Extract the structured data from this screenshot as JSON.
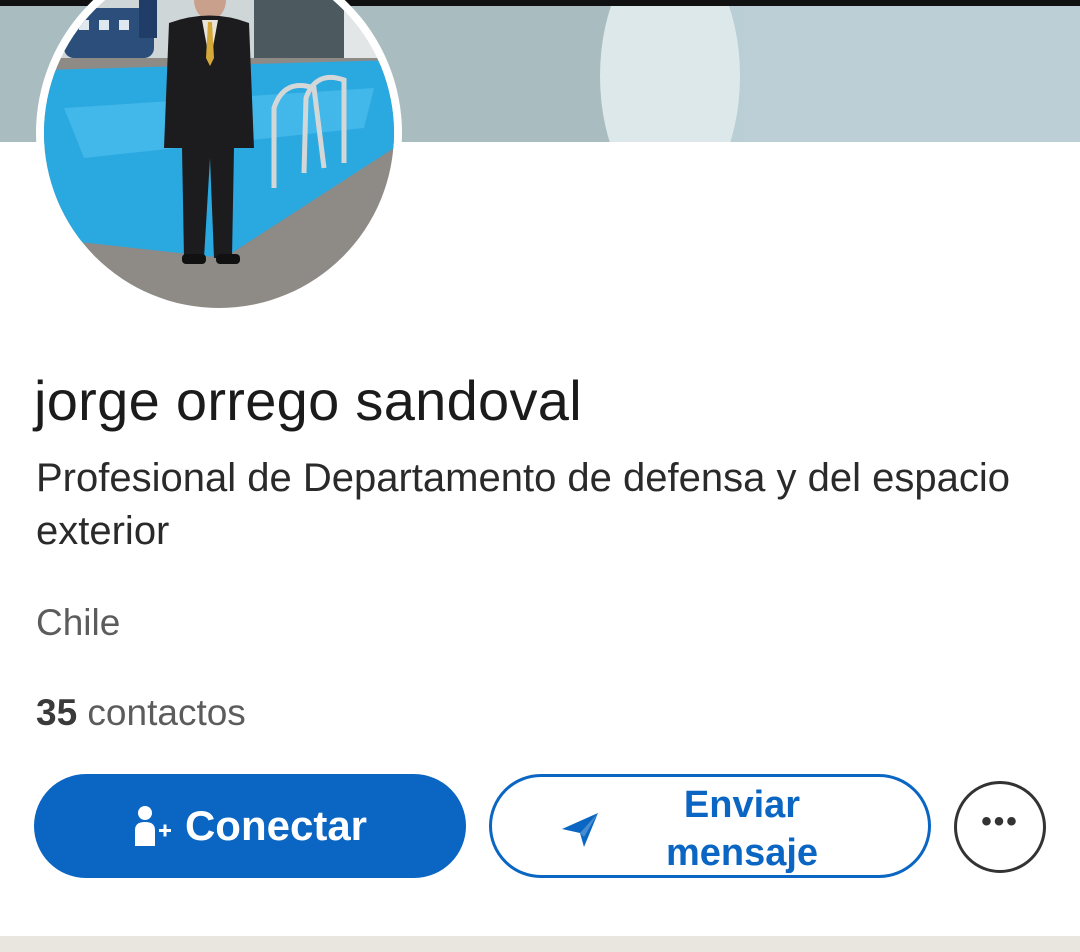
{
  "profile": {
    "name": "jorge orrego sandoval",
    "headline": "Profesional de Departamento de defensa y del espacio exterior",
    "location": "Chile",
    "connections_count": "35",
    "connections_label": " contactos"
  },
  "actions": {
    "connect_label": "Conectar",
    "message_label": "Enviar mensaje",
    "more_label": "•••"
  },
  "icons": {
    "connect": "add-person-icon",
    "message": "send-icon",
    "more": "more-options-icon"
  },
  "colors": {
    "accent": "#0a66c2",
    "banner": "#a9bcbf",
    "pool": "#2aa8e0"
  }
}
